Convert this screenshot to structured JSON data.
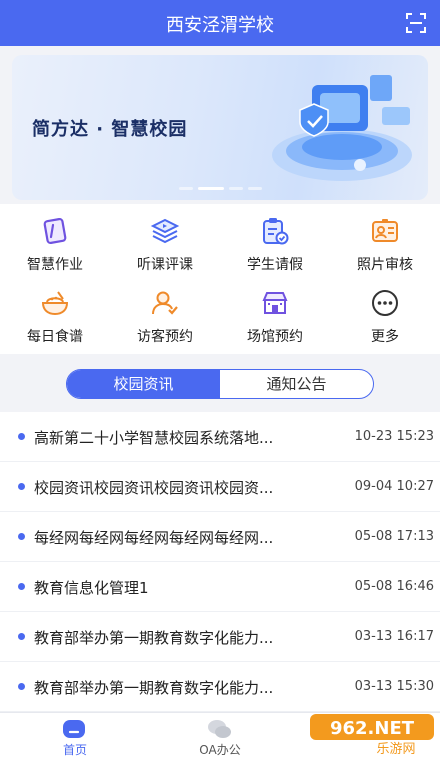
{
  "header": {
    "title": "西安泾渭学校"
  },
  "banner": {
    "slogan": "简方达 · 智慧校园",
    "slides": 4,
    "active_slide": 2
  },
  "grid": {
    "items": [
      {
        "label": "智慧作业",
        "icon": "homework-icon"
      },
      {
        "label": "听课评课",
        "icon": "lecture-icon"
      },
      {
        "label": "学生请假",
        "icon": "leave-icon"
      },
      {
        "label": "照片审核",
        "icon": "photo-review-icon"
      },
      {
        "label": "每日食谱",
        "icon": "recipe-icon"
      },
      {
        "label": "访客预约",
        "icon": "visitor-icon"
      },
      {
        "label": "场馆预约",
        "icon": "venue-icon"
      },
      {
        "label": "更多",
        "icon": "more-icon"
      }
    ]
  },
  "tabs": [
    {
      "label": "校园资讯",
      "active": true
    },
    {
      "label": "通知公告",
      "active": false
    }
  ],
  "news": [
    {
      "title": "高新第二十小学智慧校园系统落地...",
      "date": "10-23 15:23"
    },
    {
      "title": "校园资讯校园资讯校园资讯校园资...",
      "date": "09-04 10:27"
    },
    {
      "title": "每经网每经网每经网每经网每经网...",
      "date": "05-08 17:13"
    },
    {
      "title": "教育信息化管理1",
      "date": "05-08 16:46"
    },
    {
      "title": "教育部举办第一期教育数字化能力...",
      "date": "03-13 16:17"
    },
    {
      "title": "教育部举办第一期教育数字化能力...",
      "date": "03-13 15:30"
    }
  ],
  "bottom_nav": [
    {
      "label": "首页",
      "active": true
    },
    {
      "label": "OA办公",
      "active": false
    }
  ],
  "watermark": {
    "text": "962.NET",
    "sub": "乐游网"
  },
  "colors": {
    "primary": "#4a69f0",
    "purple": "#6f52e0",
    "orange": "#ef8a2a",
    "text": "#222222"
  }
}
